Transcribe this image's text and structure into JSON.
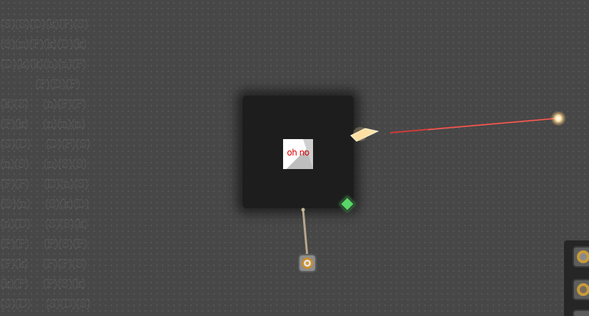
{
  "scene": {
    "tile_rows": [
      "(S)(S)(D)(k)(P)(S)",
      "(S)(n)(P)(k)(D)(k)",
      "(D)(k)(k)(n)(n)(P)",
      "            (P)(D)(P)",
      "(k)(S)     (n)(P)(P)",
      "(P)(k)     (n)(n)(n)",
      "(S)(D)     (D)(P)(S)",
      "(n)(S)     (n)(S)(S)",
      "(P)(P)     (D)(n)(S)",
      "(D)(n)     (S)(k)(D)",
      "(n)(D)     (S)(S)(k)",
      "(P)(P)     (P)(S)(P)",
      "(P)(k)     (P)(P)(S)",
      "(k)(P)     (P)(S)(k)",
      "(S)(D)     (S)(D)(S)"
    ],
    "error_sprite_text": "oh no",
    "laser_color": "#e03a3a",
    "gem_color": "#59d768",
    "block_color": "#1d1d1d",
    "background_color": "#474747"
  },
  "icons": {
    "error": "missing-texture-icon",
    "gem": "green-crystal-icon",
    "unit": "mech-unit-icon",
    "slot": "block-slot-icon"
  }
}
